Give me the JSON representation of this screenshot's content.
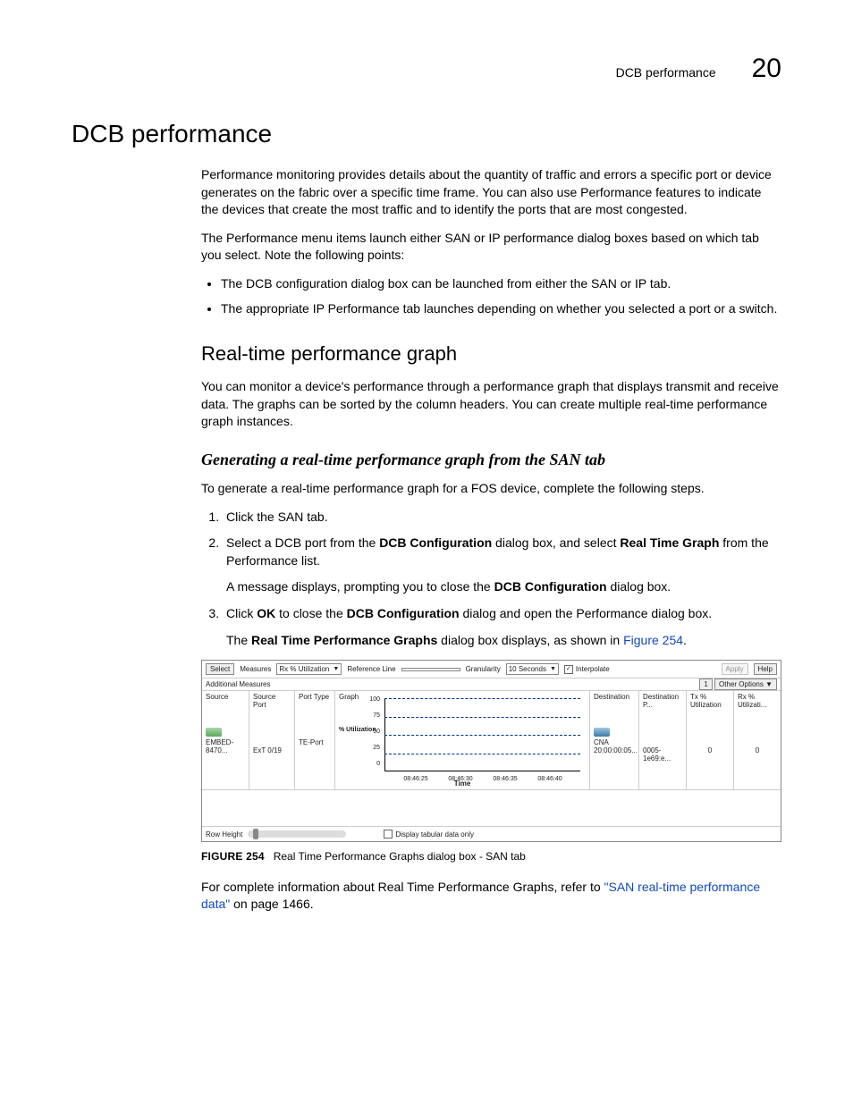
{
  "header": {
    "section_title": "DCB performance",
    "page_number": "20"
  },
  "h1": "DCB performance",
  "p1": "Performance monitoring provides details about the quantity of traffic and errors a specific port or device generates on the fabric over a specific time frame. You can also use Performance features to indicate the devices that create the most traffic and to identify the ports that are most congested.",
  "p2": "The Performance menu items launch either SAN or IP performance dialog boxes based on which tab you select. Note the following points:",
  "bullets": {
    "b1": "The DCB configuration dialog box can be launched from either the SAN or IP tab.",
    "b2": "The appropriate IP Performance tab launches depending on whether you selected a port or a switch."
  },
  "h2": "Real-time performance graph",
  "p3": "You can monitor a device's performance through a performance graph that displays transmit and receive data. The graphs can be sorted by the column headers. You can create multiple real-time performance graph instances.",
  "h3": "Generating a real-time performance graph from the SAN tab",
  "p4": "To generate a real-time performance graph for a FOS device, complete the following steps.",
  "steps": {
    "s1": "Click the SAN tab.",
    "s2a": "Select a DCB port from the ",
    "s2b": "DCB Configuration",
    "s2c": " dialog box, and select ",
    "s2d": "Real Time Graph",
    "s2e": " from the Performance list.",
    "s2_sub_a": "A message displays, prompting you to close the ",
    "s2_sub_b": "DCB Configuration",
    "s2_sub_c": " dialog box.",
    "s3a": "Click ",
    "s3b": "OK",
    "s3c": " to close the ",
    "s3d": "DCB Configuration",
    "s3e": " dialog and open the Performance dialog box.",
    "s3_sub_a": "The ",
    "s3_sub_b": "Real Time Performance Graphs",
    "s3_sub_c": " dialog box displays, as shown in ",
    "s3_sub_link": "Figure 254",
    "s3_sub_d": "."
  },
  "figure": {
    "toolbar": {
      "select_btn": "Select",
      "measures_lbl": "Measures",
      "measures_val": "Rx % Utilization",
      "refline_lbl": "Reference Line",
      "refline_val": "",
      "granularity_lbl": "Granularity",
      "granularity_val": "10 Seconds",
      "interpolate": "Interpolate",
      "apply": "Apply",
      "help": "Help"
    },
    "row2": {
      "left": "Additional Measures",
      "right_num": "1",
      "right_opt": "Other Options ▼"
    },
    "columns": {
      "source": "Source",
      "source_port": "Source Port",
      "port_type": "Port Type",
      "graph": "Graph",
      "destination": "Destination",
      "dest_port": "Destination P...",
      "tx": "Tx % Utilization",
      "rx": "Rx % Utilizati..."
    },
    "row_data": {
      "source": "EMBED-8470...",
      "source_port": "ExT 0/19",
      "port_type": "TE-Port",
      "dest_name": "CNA",
      "dest_sub": "20:00:00:05...",
      "dest_port": "0005-1e69:e...",
      "tx": "0",
      "rx": "0"
    },
    "chart": {
      "ylabel": "% Utilization",
      "xlabel": "Time"
    },
    "bottom": {
      "row_height": "Row Height",
      "display_tabular": "Display tabular data only"
    }
  },
  "chart_data": {
    "type": "line",
    "title": "",
    "xlabel": "Time",
    "ylabel": "% Utilization",
    "ylim": [
      0,
      100
    ],
    "y_ticks": [
      0,
      25,
      50,
      75,
      100
    ],
    "x_ticks": [
      "08:46:25",
      "08:46:30",
      "08:46:35",
      "08:46:40"
    ],
    "series": [
      {
        "name": "Rx % Utilization",
        "values": [
          0,
          0,
          0,
          0
        ]
      }
    ]
  },
  "figure_caption": {
    "label": "FIGURE 254",
    "text": "Real Time Performance Graphs dialog box - SAN tab"
  },
  "p_final_a": "For complete information about Real Time Performance Graphs, refer to ",
  "p_final_link": "\"SAN real-time performance data\"",
  "p_final_b": " on page 1466."
}
